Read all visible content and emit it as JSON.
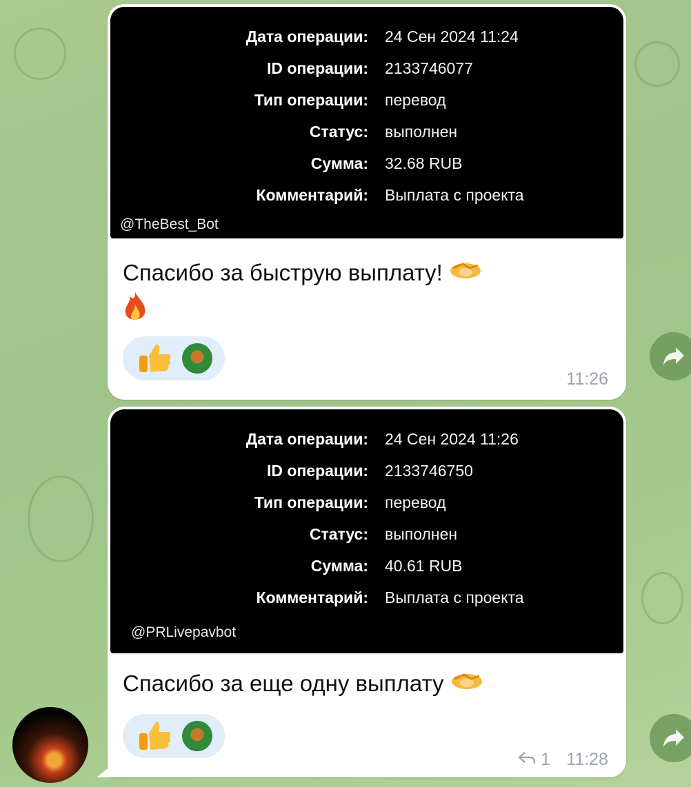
{
  "messages": [
    {
      "receipt": {
        "rows": [
          {
            "label": "Дата операции:",
            "value": "24 Сен 2024 11:24"
          },
          {
            "label": "ID операции:",
            "value": "2133746077"
          },
          {
            "label": "Тип операции:",
            "value": "перевод"
          },
          {
            "label": "Статус:",
            "value": "выполнен"
          },
          {
            "label": "Сумма:",
            "value": "32.68 RUB"
          },
          {
            "label": "Комментарий:",
            "value": "Выплата с проекта"
          }
        ],
        "bot": "@TheBest_Bot"
      },
      "text": "Спасибо за быструю выплату!",
      "emojis": [
        "handshake-emoji",
        "fire-emoji"
      ],
      "reactions": [
        "thumbs-up",
        "monkey-money-sticker"
      ],
      "time": "11:26"
    },
    {
      "receipt": {
        "rows": [
          {
            "label": "Дата операции:",
            "value": "24 Сен 2024 11:26"
          },
          {
            "label": "ID операции:",
            "value": "2133746750"
          },
          {
            "label": "Тип операции:",
            "value": "перевод"
          },
          {
            "label": "Статус:",
            "value": "выполнен"
          },
          {
            "label": "Сумма:",
            "value": "40.61 RUB"
          },
          {
            "label": "Комментарий:",
            "value": "Выплата с проекта"
          }
        ],
        "bot": "@PRLivepavbot"
      },
      "text": "Спасибо за еще одну выплату",
      "emojis": [
        "handshake-emoji"
      ],
      "reactions": [
        "thumbs-up",
        "monkey-money-sticker"
      ],
      "replies": "1",
      "time": "11:28"
    }
  ],
  "colors": {
    "bubble": "#ffffff",
    "chat_bg": "#a4c98c",
    "meta": "#9aa3ab",
    "reaction_bg": "#e1eef9"
  }
}
